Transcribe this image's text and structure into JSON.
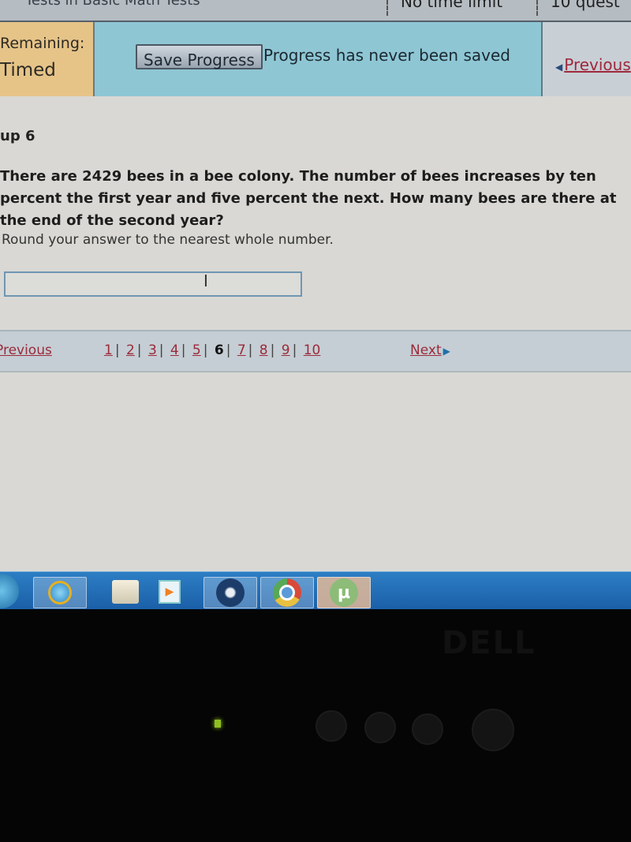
{
  "topbar": {
    "title": "Tests in Basic Math Tests",
    "time_limit": "No time limit",
    "questions": "10 quest"
  },
  "status": {
    "remaining_label": "Remaining:",
    "remaining_value": "Timed",
    "save_button": "Save Progress",
    "save_message": "Progress has never been saved",
    "previous_top": "Previous"
  },
  "question": {
    "number_label": "up 6",
    "text": "There are 2429 bees in a bee colony. The number of bees increases by ten percent the first year and five percent the next. How many bees are there at the end of the second year?",
    "hint": "Round your answer to the nearest whole number.",
    "answer_value": ""
  },
  "nav": {
    "previous": "Previous",
    "next": "Next",
    "pages": [
      "1",
      "2",
      "3",
      "4",
      "5",
      "6",
      "7",
      "8",
      "9",
      "10"
    ],
    "current_page": "6"
  },
  "taskbar": {
    "items": [
      {
        "name": "internet-explorer",
        "active": true
      },
      {
        "name": "file-explorer",
        "active": false
      },
      {
        "name": "media-player",
        "active": false
      },
      {
        "name": "steam",
        "active": true
      },
      {
        "name": "chrome",
        "active": true
      },
      {
        "name": "utorrent",
        "active": true
      }
    ]
  },
  "hardware": {
    "brand": "DELL"
  }
}
